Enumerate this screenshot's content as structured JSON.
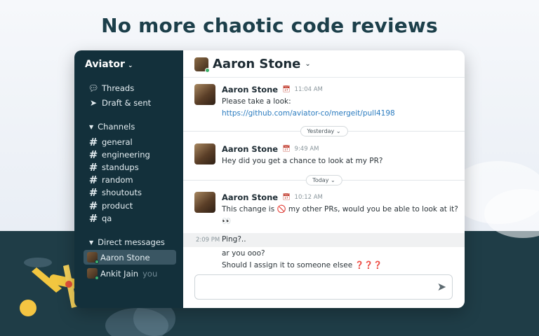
{
  "headline": "No more chaotic code reviews",
  "sidebar": {
    "workspace": "Aviator",
    "threads": "Threads",
    "drafts": "Draft & sent",
    "channels_header": "Channels",
    "channels": [
      "general",
      "engineering",
      "standups",
      "random",
      "shoutouts",
      "product",
      "qa"
    ],
    "dm_header": "Direct messages",
    "dms": [
      {
        "name": "Aaron Stone",
        "suffix": ""
      },
      {
        "name": "Ankit Jain",
        "suffix": "you"
      }
    ]
  },
  "chat": {
    "title": "Aaron Stone",
    "messages": [
      {
        "author": "Aaron Stone",
        "time": "11:04 AM",
        "lines": [
          "Please take a look:"
        ],
        "link": "https://github.com/aviator-co/mergeit/pull4198"
      },
      {
        "author": "Aaron Stone",
        "time": "9:49 AM",
        "lines": [
          "Hey did you get a chance to look at my PR?"
        ]
      },
      {
        "author": "Aaron Stone",
        "time": "10:12 AM",
        "lines": [
          "This change is 🚫 my other PRs, would you be able to look at it?",
          "👀"
        ]
      }
    ],
    "dividers": [
      "Yesterday",
      "Today"
    ],
    "followups": [
      {
        "time": "2:09 PM",
        "text": "Ping?.."
      },
      {
        "time": "",
        "text": "ar you ooo?"
      },
      {
        "time": "",
        "text": "Should I assign it to someone elsee ❓❓❓"
      }
    ]
  },
  "colors": {
    "sidebar_bg": "#13303b",
    "accent_link": "#2a7bbf",
    "headline": "#1c3f4a"
  }
}
